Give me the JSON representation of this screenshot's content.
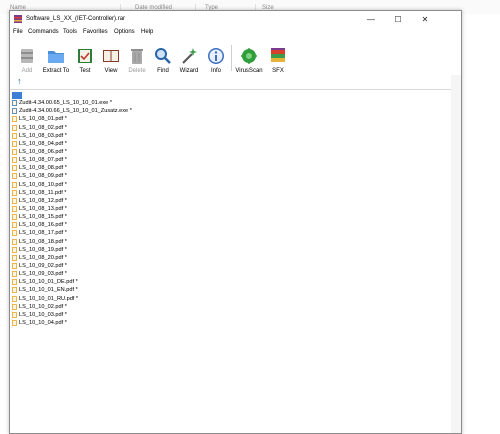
{
  "background_columns": [
    "Name",
    "Date modified",
    "Type",
    "Size"
  ],
  "window": {
    "title": "Software_LS_XX_(IET-Controller).rar",
    "controls": {
      "minimize": "—",
      "maximize": "☐",
      "close": "✕"
    }
  },
  "menu": [
    "File",
    "Commands",
    "Tools",
    "Favorites",
    "Options",
    "Help"
  ],
  "toolbar": [
    {
      "label": "Add",
      "icon": "add-archive-icon",
      "enabled": false
    },
    {
      "label": "Extract To",
      "icon": "extract-folder-icon",
      "enabled": true
    },
    {
      "label": "Test",
      "icon": "test-book-icon",
      "enabled": true
    },
    {
      "label": "View",
      "icon": "view-book-icon",
      "enabled": true
    },
    {
      "label": "Delete",
      "icon": "delete-trash-icon",
      "enabled": false
    },
    {
      "label": "Find",
      "icon": "find-magnifier-icon",
      "enabled": true
    },
    {
      "label": "Wizard",
      "icon": "wizard-wand-icon",
      "enabled": true
    },
    {
      "label": "Info",
      "icon": "info-icon",
      "enabled": true
    },
    {
      "label": "VirusScan",
      "icon": "virusscan-icon",
      "enabled": true
    },
    {
      "label": "SFX",
      "icon": "sfx-books-icon",
      "enabled": true
    }
  ],
  "up_arrow": "↑",
  "files": [
    {
      "name": "Zudit-4.34.00.65_LS_10_10_01.exe *",
      "type": "exe"
    },
    {
      "name": "Zudit-4.34.00.66_LS_10_10_01_Zusatz.exe *",
      "type": "exe"
    },
    {
      "name": "LS_10_08_01.pdf *",
      "type": "pdf"
    },
    {
      "name": "LS_10_08_02.pdf *",
      "type": "pdf"
    },
    {
      "name": "LS_10_08_03.pdf *",
      "type": "pdf"
    },
    {
      "name": "LS_10_08_04.pdf *",
      "type": "pdf"
    },
    {
      "name": "LS_10_08_06.pdf *",
      "type": "pdf"
    },
    {
      "name": "LS_10_08_07.pdf *",
      "type": "pdf"
    },
    {
      "name": "LS_10_08_08.pdf *",
      "type": "pdf"
    },
    {
      "name": "LS_10_08_09.pdf *",
      "type": "pdf"
    },
    {
      "name": "LS_10_08_10.pdf *",
      "type": "pdf"
    },
    {
      "name": "LS_10_08_11.pdf *",
      "type": "pdf"
    },
    {
      "name": "LS_10_08_12.pdf *",
      "type": "pdf"
    },
    {
      "name": "LS_10_08_13.pdf *",
      "type": "pdf"
    },
    {
      "name": "LS_10_08_15.pdf *",
      "type": "pdf"
    },
    {
      "name": "LS_10_08_16.pdf *",
      "type": "pdf"
    },
    {
      "name": "LS_10_08_17.pdf *",
      "type": "pdf"
    },
    {
      "name": "LS_10_08_18.pdf *",
      "type": "pdf"
    },
    {
      "name": "LS_10_08_19.pdf *",
      "type": "pdf"
    },
    {
      "name": "LS_10_08_20.pdf *",
      "type": "pdf"
    },
    {
      "name": "LS_10_09_02.pdf *",
      "type": "pdf"
    },
    {
      "name": "LS_10_09_03.pdf *",
      "type": "pdf"
    },
    {
      "name": "LS_10_10_01_DE.pdf *",
      "type": "pdf"
    },
    {
      "name": "LS_10_10_01_EN.pdf *",
      "type": "pdf"
    },
    {
      "name": "LS_10_10_01_RU.pdf *",
      "type": "pdf"
    },
    {
      "name": "LS_10_10_02.pdf *",
      "type": "pdf"
    },
    {
      "name": "LS_10_10_03.pdf *",
      "type": "pdf"
    },
    {
      "name": "LS_10_10_04.pdf *",
      "type": "pdf"
    }
  ],
  "colors": {
    "accent": "#3d7fd4",
    "pdf_icon": "#e8b54a",
    "exe_icon": "#6c8fb8",
    "disabled_text": "#9a9a9a"
  }
}
